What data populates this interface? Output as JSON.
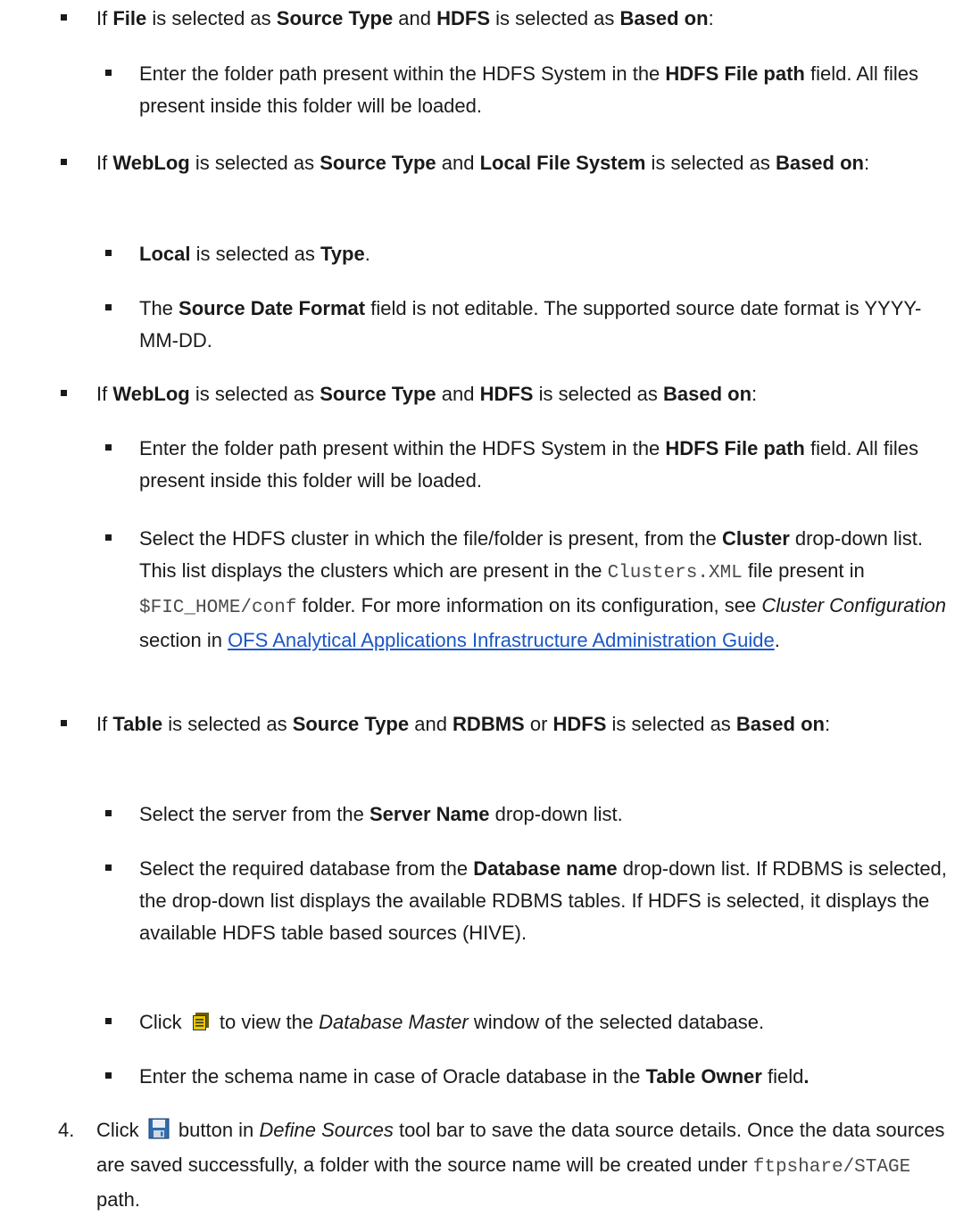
{
  "bullets": {
    "b1": {
      "t1": "If ",
      "t2": "File",
      "t3": "  is selected as ",
      "t4": "Source Type",
      "t5": " and ",
      "t6": "HDFS",
      "t7": " is selected as ",
      "t8": "Based on",
      "t9": ":"
    },
    "b1a": {
      "t1": "Enter the folder path present within the HDFS System in the ",
      "t2": "HDFS File path",
      "t3": " field. All files present inside this folder will be loaded."
    },
    "b2": {
      "t1": "If ",
      "t2": "WebLog",
      "t3": " is selected as ",
      "t4": "Source Type",
      "t5": " and ",
      "t6": "Local File System",
      "t7": " is selected as ",
      "t8": "Based on",
      "t9": ":"
    },
    "b2a": {
      "t1": "Local",
      "t2": " is selected as ",
      "t3": "Type",
      "t4": "."
    },
    "b2b": {
      "t1": "The ",
      "t2": "Source Date Format",
      "t3": " field is not editable. The supported source date format is YYYY-MM-DD."
    },
    "b3": {
      "t1": "If ",
      "t2": "WebLog",
      "t3": " is selected as ",
      "t4": "Source Type",
      "t5": " and ",
      "t6": "HDFS",
      "t7": " is selected as ",
      "t8": "Based on",
      "t9": ":"
    },
    "b3a": {
      "t1": "Enter the folder path present within the HDFS System in the ",
      "t2": "HDFS File path",
      "t3": " field. All files present inside this folder will be loaded."
    },
    "b3b": {
      "t1": "Select the HDFS cluster in which the file/folder is present, from the ",
      "t2": "Cluster",
      "t3": " drop-down list. This list displays the clusters which are present in the ",
      "t4": "Clusters.XML",
      "t5": " file present in ",
      "t6": "$FIC_HOME/conf",
      "t7": " folder. For more information on its configuration, see ",
      "t8": "Cluster Configuration",
      "t9": " section in ",
      "link1": "OFS",
      "link2": "Analytical Applications Infrastructure Administration Guide",
      "t10": "."
    },
    "b4": {
      "t1": "If ",
      "t2": "Table",
      "t3": " is selected as ",
      "t4": "Source Type",
      "t5": " and ",
      "t6": "RDBMS",
      "t7": " or ",
      "t8": "HDFS",
      "t9": " is selected as ",
      "t10": "Based",
      "t11": "on",
      "t12": ":"
    },
    "b4a": {
      "t1": "Select the server from the ",
      "t2": "Server Name",
      "t3": " drop-down list."
    },
    "b4b": {
      "t1": "Select the required database from the ",
      "t2": "Database name",
      "t3": " drop-down list. If RDBMS is selected, the drop-down list displays the available RDBMS tables. If HDFS is selected, it displays the available HDFS table based sources (HIVE)."
    },
    "b4c": {
      "t1": "Click ",
      "t2": " to view the ",
      "t3": "Database Master",
      "t4": " window of the selected database."
    },
    "b4d": {
      "t1": "Enter the schema name in case of Oracle database in the ",
      "t2": "Table Owner",
      "t3": " field",
      "t4": "."
    }
  },
  "step4": {
    "number": "4.",
    "t1": "Click ",
    "t2": " button in ",
    "t3": "Define Sources",
    "t4": " tool bar to save the data source details. Once the data sources are saved successfully, a folder with the source name will be created under ",
    "t5": "ftpshare/STAGE",
    "t6": " path."
  },
  "icons": {
    "list": "list-view-icon",
    "save": "save-floppy-icon",
    "list_color": "#e8c800",
    "save_color": "#2f6db0"
  }
}
